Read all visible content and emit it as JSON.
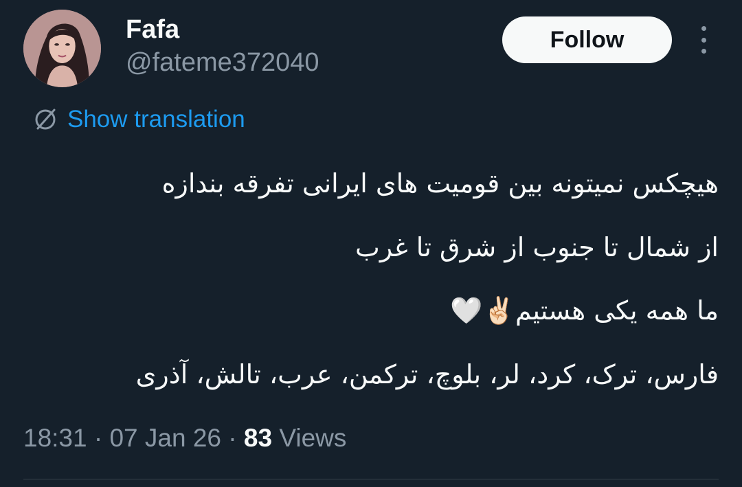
{
  "author": {
    "display_name": "Fafa",
    "handle": "@fateme372040"
  },
  "actions": {
    "follow_label": "Follow",
    "more_icon": "more-vertical-icon"
  },
  "translation": {
    "label": "Show translation",
    "icon": "translate-globe-icon",
    "color": "#1d9bf0"
  },
  "tweet": {
    "lines": [
      "هیچکس نمیتونه بین قومیت های ایرانی تفرقه بندازه",
      "از شمال تا جنوب از شرق تا غرب",
      "ما همه یکی هستیم✌🏻🤍",
      "فارس، ترک، کرد، لر، بلوچ، ترکمن، عرب، تالش، آذری"
    ]
  },
  "meta": {
    "time": "18:31",
    "separator1": "·",
    "date": "07 Jan 26",
    "separator2": "·",
    "views_count": "83",
    "views_label": "Views"
  },
  "colors": {
    "background": "#15202b",
    "text_primary": "#f7f9f9",
    "text_secondary": "#8b98a5",
    "accent": "#1d9bf0"
  }
}
